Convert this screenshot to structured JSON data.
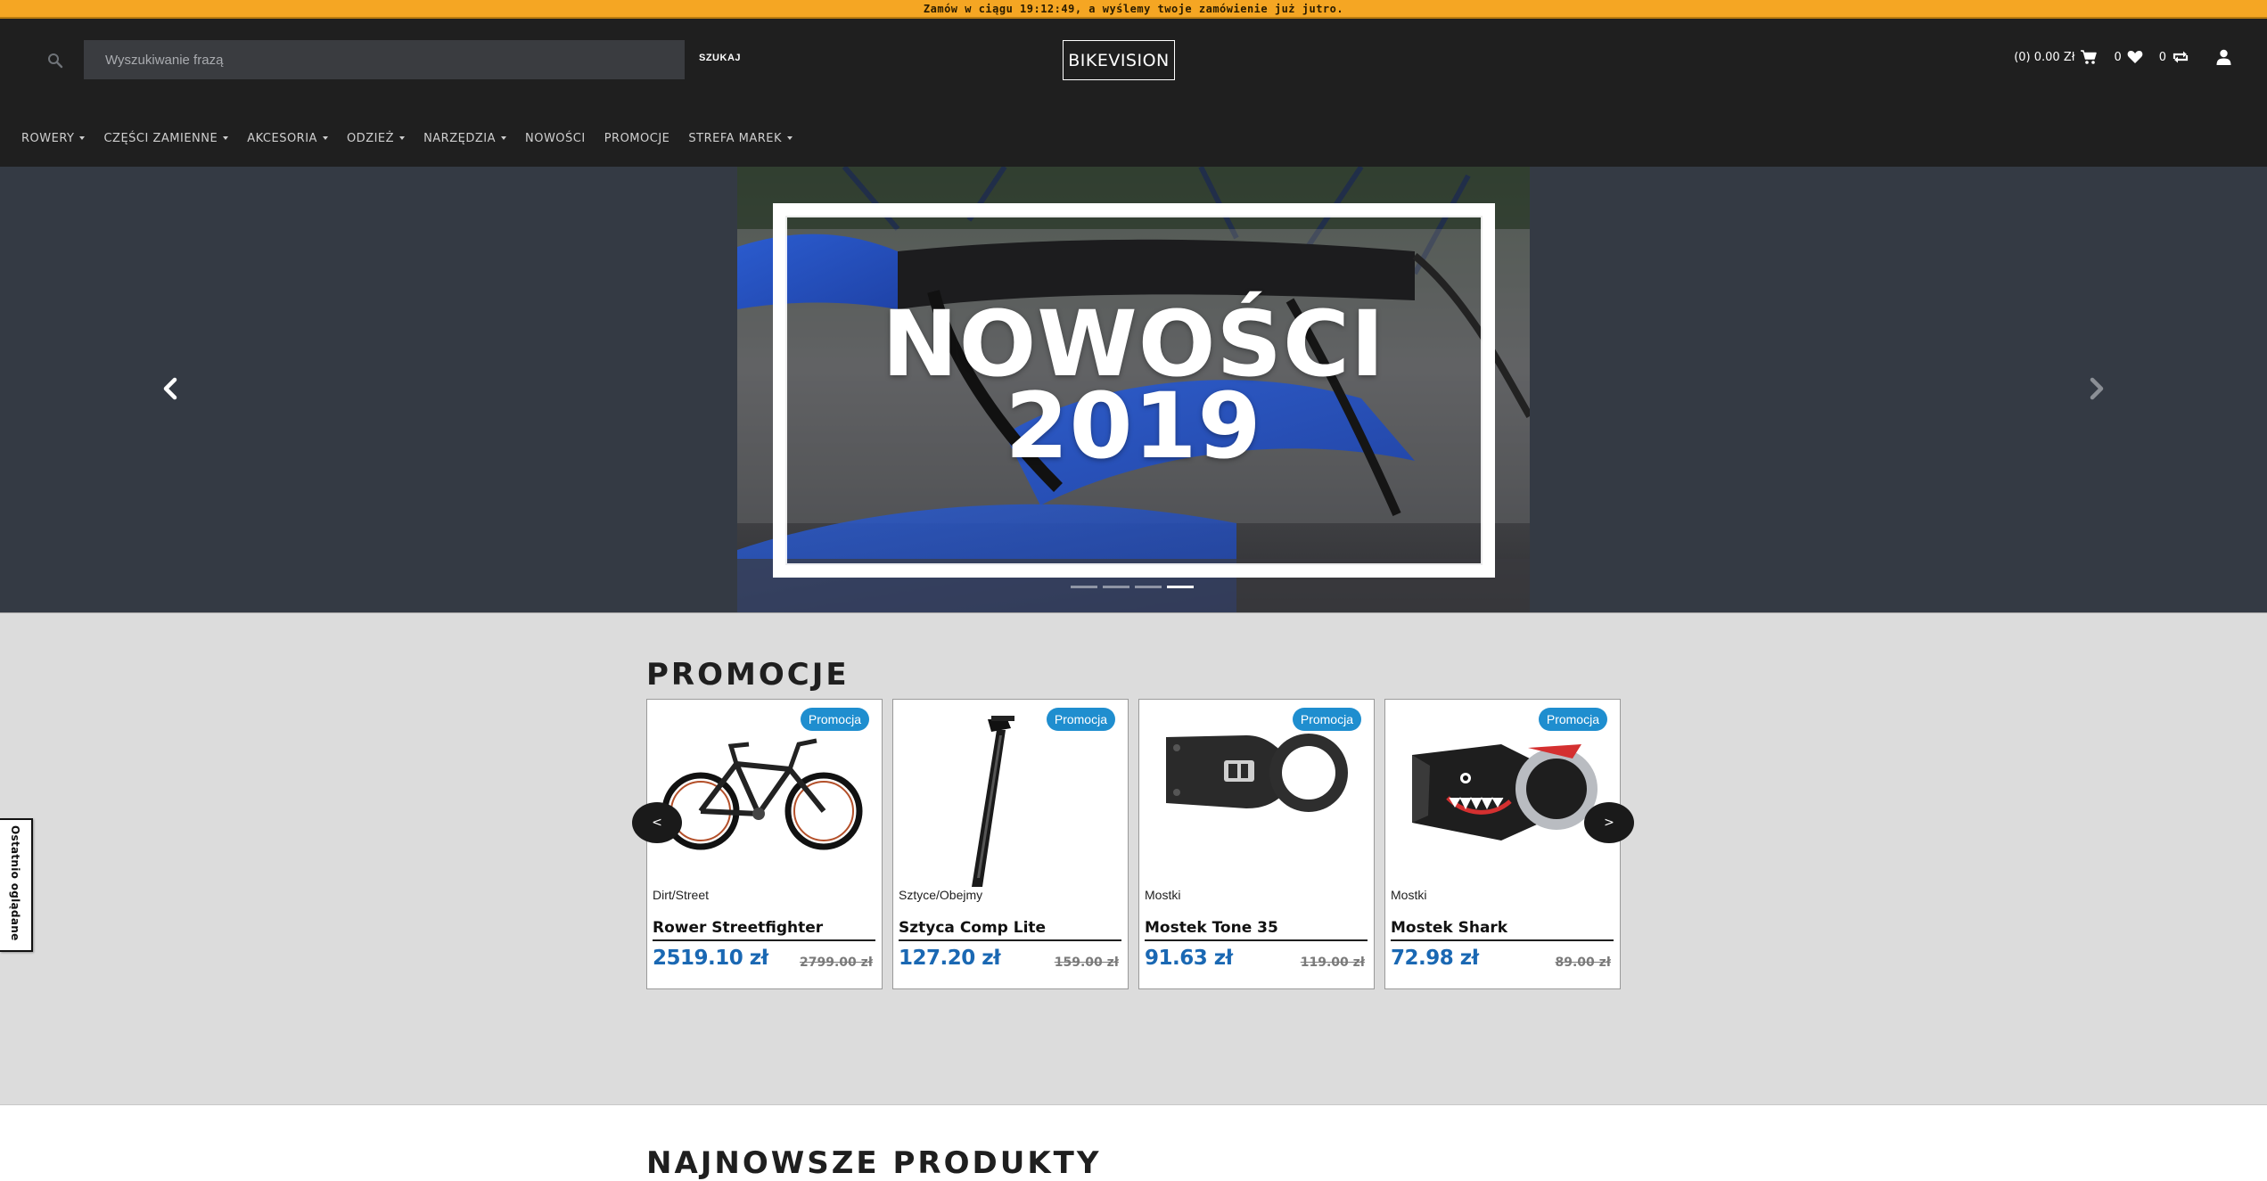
{
  "colors": {
    "topbar": "#f5a623",
    "header": "#1f1f1f",
    "hero_bg": "#343a44",
    "promo_bg": "#dcdcdc",
    "badge": "#1f8ecf",
    "price": "#1a68b3"
  },
  "topbar": {
    "text": "Zamów w ciągu 19:12:49, a wyślemy twoje zamówienie już jutro."
  },
  "header": {
    "search": {
      "placeholder": "Wyszukiwanie frazą",
      "button": "SZUKAJ"
    },
    "logo": "BIKEVISION",
    "cart": {
      "label": "(0) 0.00 Zł",
      "icon": "cart-icon"
    },
    "wishlist": {
      "count": "0",
      "icon": "heart-icon"
    },
    "compare": {
      "count": "0",
      "icon": "compare-icon"
    },
    "account": {
      "icon": "user-icon"
    }
  },
  "nav": [
    {
      "label": "ROWERY",
      "dropdown": true
    },
    {
      "label": "CZĘŚCI ZAMIENNE",
      "dropdown": true
    },
    {
      "label": "AKCESORIA",
      "dropdown": true
    },
    {
      "label": "ODZIEŻ",
      "dropdown": true
    },
    {
      "label": "NARZĘDZIA",
      "dropdown": true
    },
    {
      "label": "NOWOŚCI",
      "dropdown": false
    },
    {
      "label": "PROMOCJE",
      "dropdown": false
    },
    {
      "label": "STREFA MAREK",
      "dropdown": true
    }
  ],
  "hero": {
    "line1": "NOWOŚCI",
    "line2": "2019",
    "slides": 4,
    "active_slide": 4
  },
  "promo": {
    "title": "PROMOCJE",
    "prev": "<",
    "next": ">",
    "products": [
      {
        "badge": "Promocja",
        "category": "Dirt/Street",
        "name": "Rower Streetfighter",
        "price": "2519.10 zł",
        "old_price": "2799.00 zł",
        "image": "bike"
      },
      {
        "badge": "Promocja",
        "category": "Sztyce/Obejmy",
        "name": "Sztyca Comp Lite",
        "price": "127.20 zł",
        "old_price": "159.00 zł",
        "image": "seatpost"
      },
      {
        "badge": "Promocja",
        "category": "Mostki",
        "name": "Mostek Tone 35",
        "price": "91.63 zł",
        "old_price": "119.00 zł",
        "image": "stem"
      },
      {
        "badge": "Promocja",
        "category": "Mostki",
        "name": "Mostek Shark",
        "price": "72.98 zł",
        "old_price": "89.00 zł",
        "image": "stem-shark"
      }
    ]
  },
  "recent": {
    "label": "Ostatnio oglądane"
  },
  "newest": {
    "title": "NAJNOWSZE PRODUKTY"
  }
}
